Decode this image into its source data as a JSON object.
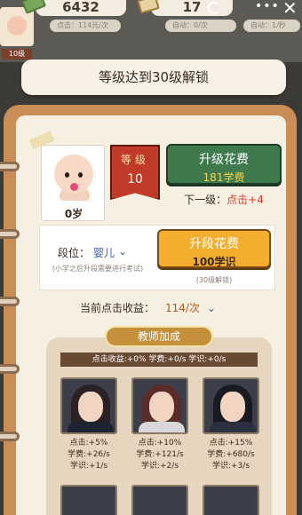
{
  "hud": {
    "money": "6432",
    "books": "17",
    "row2_left": "点击：114元/次",
    "row2_mid": "自动：0/次",
    "row2_right": "自动：1/秒",
    "level_tag": "10级",
    "close_glyph": "✕",
    "dots_glyph": "•••"
  },
  "banner": {
    "text": "等级达到30级解锁"
  },
  "profile": {
    "age": "0岁"
  },
  "level": {
    "label": "等级",
    "value": "10"
  },
  "upgrade": {
    "title": "升级花费",
    "cost": "181学费"
  },
  "next_level": {
    "prefix": "下一级：",
    "value": "点击+4"
  },
  "stage": {
    "label": "段位：",
    "value": "婴儿",
    "note": "(小学之后升段需要进行考试)",
    "button_title": "升段花费",
    "button_cost": "100学识",
    "button_note": "(30级解锁)"
  },
  "income": {
    "label": "当前点击收益：",
    "value": "114/次"
  },
  "teachers": {
    "title": "教师加成",
    "stats": "点击收益:+0%   学费:+0/s   学识:+0/s",
    "cards": [
      {
        "line1": "点击:+5%",
        "line2": "学费:+26/s",
        "line3": "学识:+1/s"
      },
      {
        "line1": "点击:+10%",
        "line2": "学费:+121/s",
        "line3": "学识:+2/s"
      },
      {
        "line1": "点击:+15%",
        "line2": "学费:+680/s",
        "line3": "学识:+3/s"
      }
    ]
  },
  "icons": {
    "chevron": "⌄",
    "colors": {
      "accent_green": "#3e7a4d",
      "accent_orange": "#f2ae2c",
      "ribbon_red": "#c03a27",
      "book_brown": "#c98d55"
    }
  }
}
